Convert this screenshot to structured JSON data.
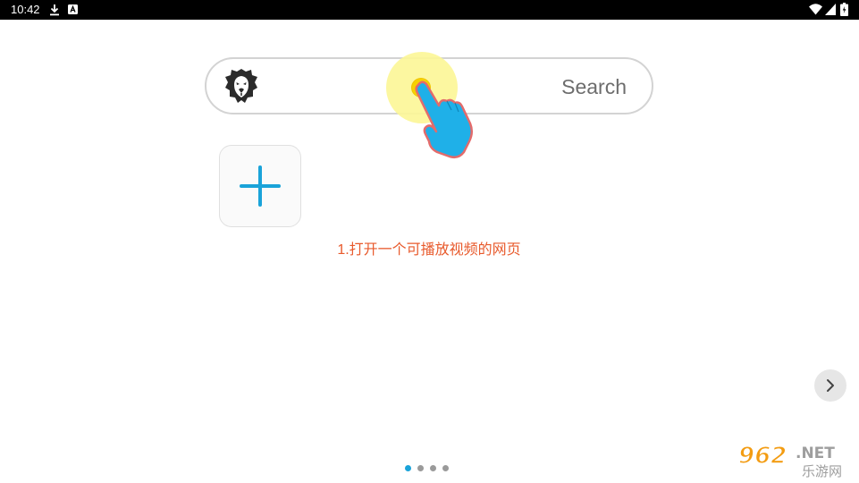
{
  "status_bar": {
    "time": "10:42",
    "icons": [
      "download-icon",
      "a-notification-icon",
      "wifi-icon",
      "signal-icon",
      "battery-icon"
    ]
  },
  "search": {
    "placeholder": "Search",
    "logo": "lion-icon"
  },
  "add_tile": {
    "icon": "plus-icon",
    "accent_color": "#1aa3d9"
  },
  "caption": {
    "text": "1.打开一个可播放视频的网页",
    "color": "#e85a2c"
  },
  "navigation": {
    "next_icon": "chevron-right-icon",
    "page_count": 4,
    "current_page": 1
  },
  "watermark": {
    "text": "962.NET",
    "subtext": "乐游网"
  },
  "colors": {
    "accent": "#1aa3d9",
    "caption": "#e85a2c",
    "highlight": "#fcf696",
    "hand": "#1fb0e8"
  }
}
